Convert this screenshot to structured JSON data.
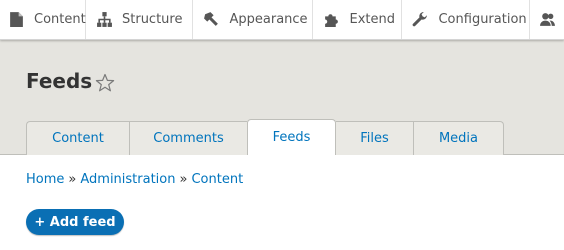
{
  "toolbar": {
    "items": [
      {
        "label": "Content",
        "icon": "content-icon"
      },
      {
        "label": "Structure",
        "icon": "structure-icon"
      },
      {
        "label": "Appearance",
        "icon": "appearance-icon"
      },
      {
        "label": "Extend",
        "icon": "extend-icon"
      },
      {
        "label": "Configuration",
        "icon": "configuration-icon"
      },
      {
        "label": "",
        "icon": "people-icon"
      }
    ]
  },
  "page": {
    "title": "Feeds",
    "favorite_icon": "star-outline-icon"
  },
  "tabs": [
    {
      "label": "Content",
      "active": false
    },
    {
      "label": "Comments",
      "active": false
    },
    {
      "label": "Feeds",
      "active": true
    },
    {
      "label": "Files",
      "active": false
    },
    {
      "label": "Media",
      "active": false
    }
  ],
  "breadcrumb": {
    "items": [
      "Home",
      "Administration",
      "Content"
    ],
    "separator": "»"
  },
  "actions": {
    "add_feed": "+ Add feed"
  },
  "colors": {
    "link": "#0074bd",
    "header_bg": "#e5e4df",
    "button_bg": "#0a6fb4"
  }
}
